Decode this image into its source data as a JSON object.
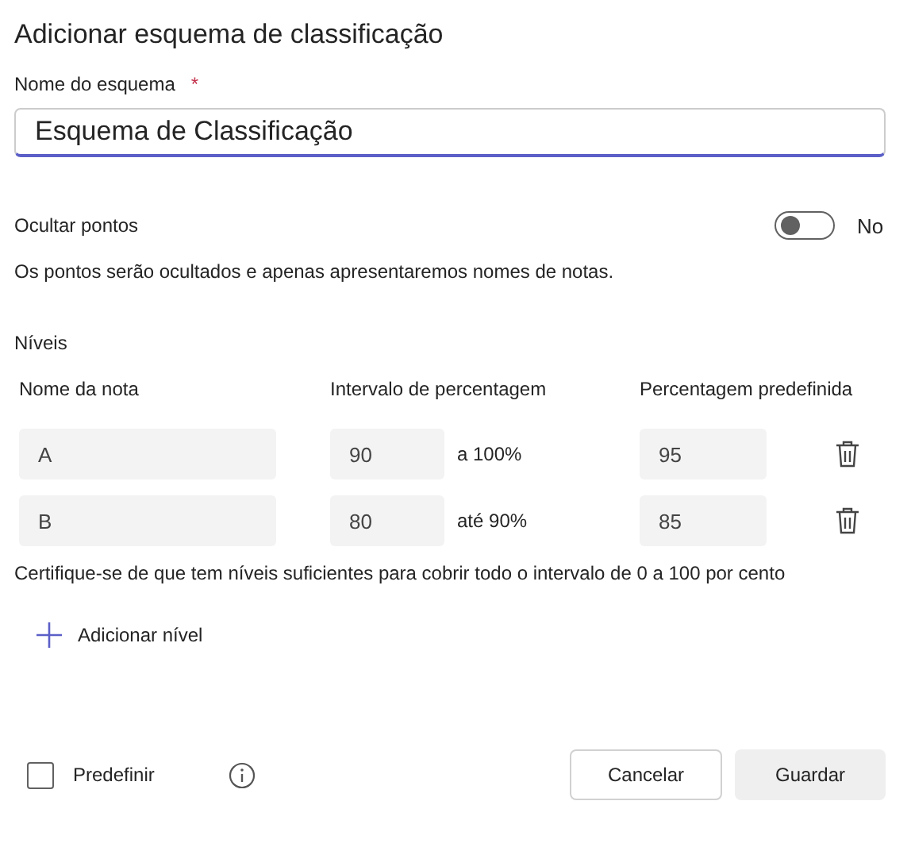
{
  "title": "Adicionar esquema de classificação",
  "scheme_name": {
    "label": "Nome do esquema",
    "required_mark": "*",
    "value": "Esquema de Classificação"
  },
  "hide_points": {
    "label": "Ocultar pontos",
    "on": false,
    "state_label": "No",
    "description": "Os pontos serão ocultados e apenas apresentaremos nomes de notas."
  },
  "levels": {
    "heading": "Níveis",
    "columns": [
      "Nome da nota",
      "Intervalo de percentagem",
      "Percentagem predefinida"
    ],
    "rows": [
      {
        "grade": "A",
        "from": "90",
        "to": "a 100%",
        "default": "95"
      },
      {
        "grade": "B",
        "from": "80",
        "to": "até 90%",
        "default": "85"
      }
    ],
    "note": "Certifique-se de que tem níveis suficientes para cobrir todo o intervalo de 0 a 100 por cento",
    "add_label": "Adicionar nível"
  },
  "footer": {
    "default_checkbox": {
      "label": "Predefinir",
      "checked": false
    },
    "buttons": [
      "Cancelar",
      "Guardar"
    ]
  }
}
